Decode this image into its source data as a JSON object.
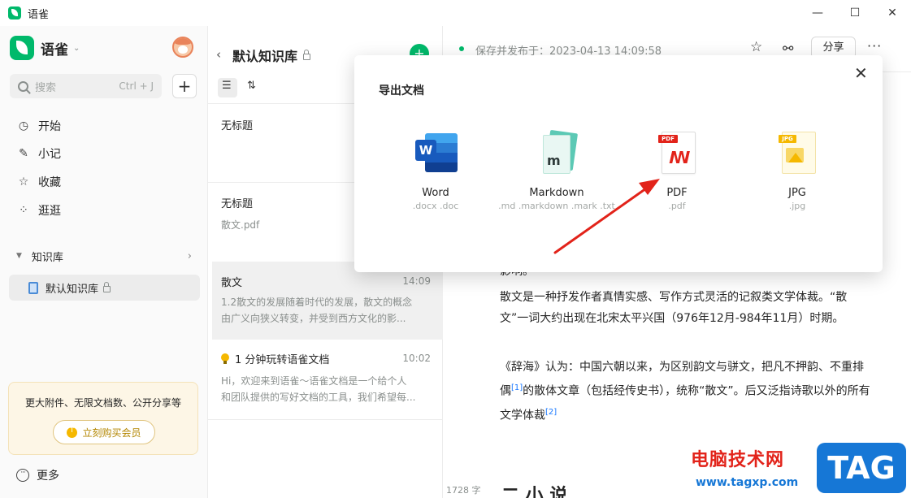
{
  "window": {
    "title": "语雀",
    "controls": [
      "—",
      "☐",
      "✕"
    ]
  },
  "sidebar": {
    "brand": "语雀",
    "search_placeholder": "搜索",
    "search_shortcut": "Ctrl + J",
    "add_label": "+",
    "nav": [
      {
        "label": "开始",
        "icon": "clock-icon"
      },
      {
        "label": "小记",
        "icon": "feather-icon"
      },
      {
        "label": "收藏",
        "icon": "star-icon"
      },
      {
        "label": "逛逛",
        "icon": "grid-icon"
      }
    ],
    "kb_header": "知识库",
    "kb_item": "默认知识库",
    "promo_text": "更大附件、无限文档数、公开分享等",
    "promo_button": "立刻购买会员",
    "more": "更多"
  },
  "doclist": {
    "title": "默认知识库",
    "items": [
      {
        "name": "无标题",
        "time": "",
        "sub": ""
      },
      {
        "name": "无标题",
        "time": "",
        "sub": "散文.pdf"
      },
      {
        "name": "散文",
        "time": "14:09",
        "sub1": "1.2散文的发展随着时代的发展，散文的概念",
        "sub2": "由广义向狭义转变，并受到西方文化的影..."
      },
      {
        "name": "1 分钟玩转语雀文档",
        "time": "10:02",
        "sub1": "Hi，欢迎来到语雀～语雀文档是一个给个人",
        "sub2": "和团队提供的写好文档的工具，我们希望每..."
      }
    ]
  },
  "editor": {
    "save_status": "保存并发布于：2023-04-13 14:09:58",
    "share_label": "分享",
    "para0": "影响。",
    "para1": "散文是一种抒发作者真情实感、写作方式灵活的记叙类文学体裁。“散文”一词大约出现在北宋太平兴国（976年12月-984年11月）时期。",
    "para2_a": "《辞海》认为：中国六朝以来，为区别韵文与骈文，把凡不押韵、不重排偶",
    "para2_sup1": "[1]",
    "para2_b": "的散体文章（包括经传史书），统称“散文”。后又泛指诗歌以外的所有文学体裁",
    "para2_sup2": "[2]",
    "word_count": "1728 字",
    "heading_fragment": "二 小 说"
  },
  "dialog": {
    "title": "导出文档",
    "options": [
      {
        "name": "Word",
        "ext": ".docx .doc",
        "icon": "word-icon"
      },
      {
        "name": "Markdown",
        "ext": ".md .markdown .mark .txt",
        "icon": "markdown-icon"
      },
      {
        "name": "PDF",
        "ext": ".pdf",
        "icon": "pdf-icon",
        "tag": "PDF"
      },
      {
        "name": "JPG",
        "ext": ".jpg",
        "icon": "jpg-icon",
        "tag": "JPG"
      }
    ]
  },
  "watermark": {
    "text": "电脑技术网",
    "url": "www.tagxp.com",
    "tag": "TAG"
  },
  "colors": {
    "brand": "#00b96b",
    "arrow": "#e2231a",
    "link": "#1677ff"
  }
}
